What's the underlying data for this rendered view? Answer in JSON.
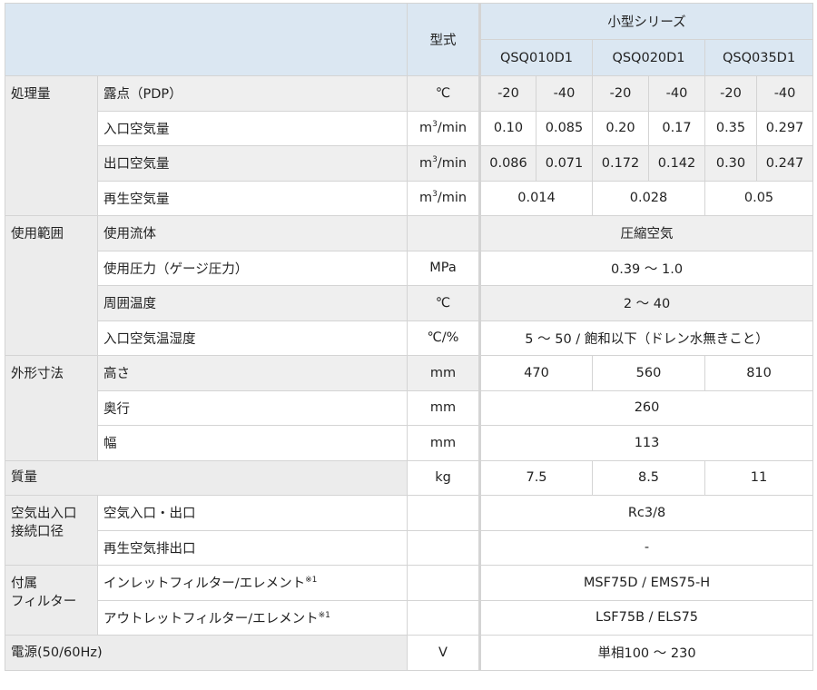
{
  "header": {
    "type_label": "型式",
    "series": "小型シリーズ",
    "models": [
      "QSQ010D1",
      "QSQ020D1",
      "QSQ035D1"
    ]
  },
  "sections": {
    "processing": {
      "label": "処理量",
      "dew": {
        "name": "露点（PDP）",
        "unit": "℃",
        "values": [
          "-20",
          "-40",
          "-20",
          "-40",
          "-20",
          "-40"
        ]
      },
      "inlet": {
        "name": "入口空気量",
        "unit_base": "m",
        "unit_sup": "3",
        "unit_tail": "/min",
        "values": [
          "0.10",
          "0.085",
          "0.20",
          "0.17",
          "0.35",
          "0.297"
        ]
      },
      "outlet": {
        "name": "出口空気量",
        "unit_base": "m",
        "unit_sup": "3",
        "unit_tail": "/min",
        "values": [
          "0.086",
          "0.071",
          "0.172",
          "0.142",
          "0.30",
          "0.247"
        ]
      },
      "regen": {
        "name": "再生空気量",
        "unit_base": "m",
        "unit_sup": "3",
        "unit_tail": "/min",
        "values": [
          "0.014",
          "0.028",
          "0.05"
        ]
      }
    },
    "usage": {
      "label": "使用範囲",
      "fluid": {
        "name": "使用流体",
        "unit": "",
        "value": "圧縮空気"
      },
      "pressure": {
        "name": "使用圧力（ゲージ圧力）",
        "unit": "MPa",
        "value": "0.39 ～ 1.0"
      },
      "ambient": {
        "name": "周囲温度",
        "unit": "℃",
        "value": "2 ～ 40"
      },
      "inlet_temp": {
        "name": "入口空気温湿度",
        "unit": "℃/%",
        "value": "5 ～ 50 / 飽和以下（ドレン水無きこと）"
      }
    },
    "dimensions": {
      "label": "外形寸法",
      "height": {
        "name": "高さ",
        "unit": "mm",
        "values": [
          "470",
          "560",
          "810"
        ]
      },
      "depth": {
        "name": "奥行",
        "unit": "mm",
        "value": "260"
      },
      "width": {
        "name": "幅",
        "unit": "mm",
        "value": "113"
      }
    },
    "mass": {
      "label": "質量",
      "unit": "kg",
      "values": [
        "7.5",
        "8.5",
        "11"
      ]
    },
    "ports": {
      "label_line1": "空気出入口",
      "label_line2": "接続口径",
      "air": {
        "name": "空気入口・出口",
        "unit": "",
        "value": "Rc3/8"
      },
      "regen_exhaust": {
        "name": "再生空気排出口",
        "unit": "",
        "value": "-"
      }
    },
    "filter": {
      "label_line1": "付属",
      "label_line2": "フィルター",
      "inlet": {
        "name": "インレットフィルター/エレメント",
        "note": "※1",
        "unit": "",
        "value": "MSF75D / EMS75-H"
      },
      "outlet": {
        "name": "アウトレットフィルター/エレメント",
        "note": "※1",
        "unit": "",
        "value": "LSF75B / ELS75"
      }
    },
    "power": {
      "label": "電源(50/60Hz)",
      "unit": "V",
      "value": "単相100 ～ 230"
    }
  }
}
